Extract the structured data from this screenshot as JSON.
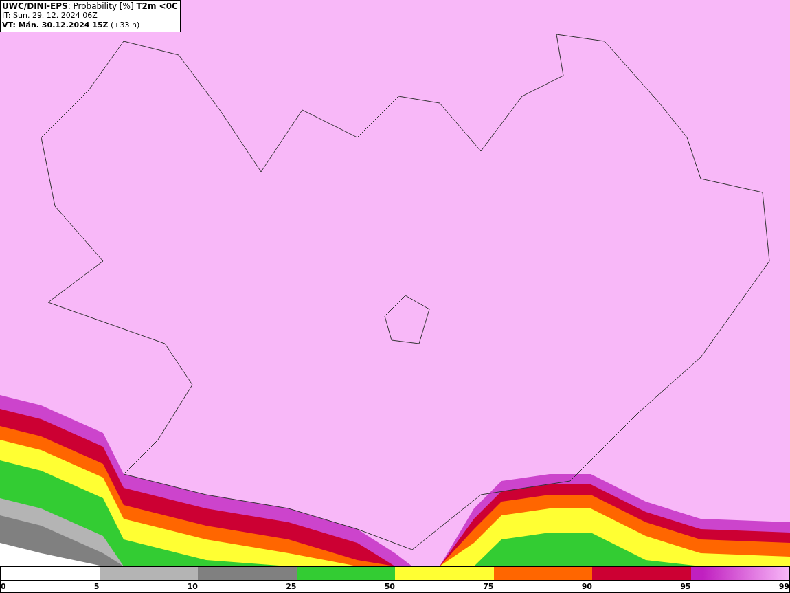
{
  "header": {
    "title": "**UWC/DINI-EPS**: Probability [%] **T2m <0C**",
    "initial_time": "IT: Sun. 29. 12. 2024 06Z",
    "valid_time": "**VT: Mán. 30.12.2024 15Z** (+33 h)"
  },
  "legend": {
    "segments": [
      {
        "color": "#ffffff"
      },
      {
        "color": "#b4b4b4"
      },
      {
        "color": "#808080"
      },
      {
        "color": "#33cc33"
      },
      {
        "color": "#ffff33"
      },
      {
        "color": "#ff6600"
      },
      {
        "color": "#cc0033"
      },
      {
        "kind": "gradient",
        "color": "#c020c0"
      }
    ],
    "labels": [
      "0",
      "5",
      "10",
      "25",
      "50",
      "75",
      "90",
      "95",
      "99"
    ]
  }
}
